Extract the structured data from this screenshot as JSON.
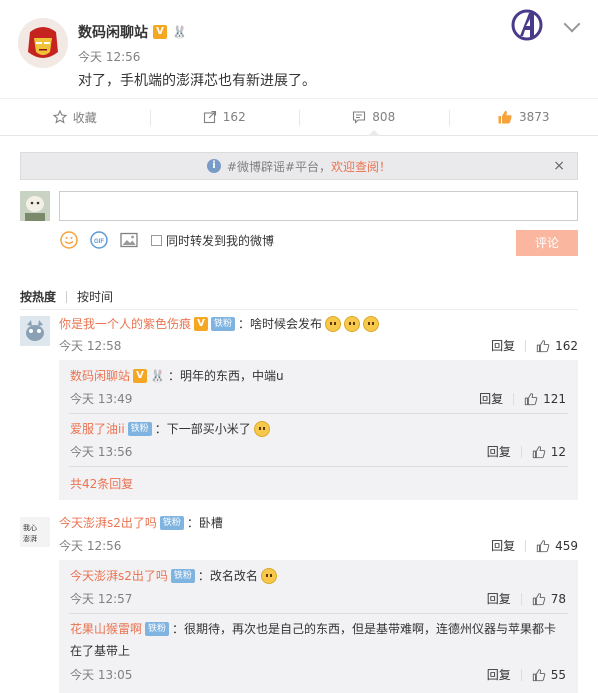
{
  "post": {
    "author": "数码闲聊站",
    "verified_badge": "V",
    "level_badge": "🐰",
    "time": "今天 12:56",
    "text": "对了，手机端的澎湃芯也有新进展了。"
  },
  "actions": {
    "favorite": "收藏",
    "forward_count": "162",
    "comment_count": "808",
    "like_count": "3873"
  },
  "composer": {
    "notice_prefix": "#微博辟谣#平台，",
    "notice_link": "欢迎查阅！",
    "close": "×",
    "input_placeholder": "",
    "forward_label": "同时转发到我的微博",
    "submit": "评论"
  },
  "sort": {
    "hot": "按热度",
    "time": "按时间"
  },
  "reply_label": "回复",
  "comments": [
    {
      "user": "你是我一个人的紫色伤痕",
      "badges": [
        "V",
        "铁粉"
      ],
      "text": "：啥时候会发布",
      "time": "今天 12:58",
      "likes": "162",
      "replies": [
        {
          "user": "数码闲聊站",
          "text": "：明年的东西，中端u",
          "time": "今天 13:49",
          "likes": "121"
        },
        {
          "user": "爱服了油ii",
          "badge": "铁粉",
          "text": "：下一部买小米了",
          "time": "今天 13:56",
          "likes": "12"
        }
      ],
      "more": "共42条回复"
    },
    {
      "user": "今天澎湃s2出了吗",
      "badge": "铁粉",
      "text": "：卧槽",
      "time": "今天 12:56",
      "likes": "459",
      "replies": [
        {
          "user": "今天澎湃s2出了吗",
          "badge": "铁粉",
          "text": "：改名改名",
          "time": "今天 12:57",
          "likes": "78"
        },
        {
          "user": "花果山猴雷啊",
          "badge": "铁粉",
          "text": "：很期待，再次也是自己的东西，但是基带难啊，连德州仪器与苹果都卡",
          "text2": "在了基带上",
          "time": "今天 13:05",
          "likes": "55"
        }
      ]
    }
  ]
}
